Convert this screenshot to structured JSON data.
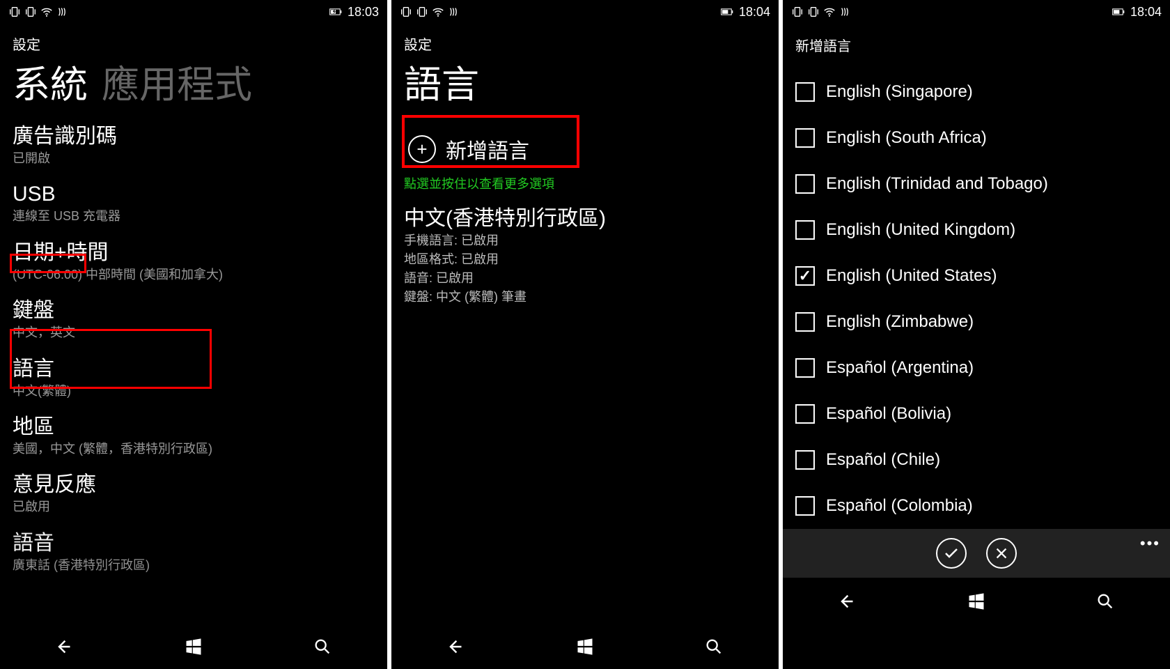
{
  "screen1": {
    "status": {
      "time": "18:03"
    },
    "header_small": "設定",
    "pivot_active": "系統",
    "pivot_inactive": "應用程式",
    "items": [
      {
        "title": "廣告識別碼",
        "sub": "已開啟"
      },
      {
        "title": "USB",
        "sub": "連線至 USB 充電器"
      },
      {
        "title": "日期+時間",
        "sub": "(UTC-06:00) 中部時間 (美國和加拿大)"
      },
      {
        "title": "鍵盤",
        "sub": "中文，英文"
      },
      {
        "title": "語言",
        "sub": "中文(繁體)"
      },
      {
        "title": "地區",
        "sub": "美國，中文 (繁體，香港特別行政區)"
      },
      {
        "title": "意見反應",
        "sub": "已啟用"
      },
      {
        "title": "語音",
        "sub": "廣東話 (香港特別行政區)"
      }
    ]
  },
  "screen2": {
    "status": {
      "time": "18:04"
    },
    "header_small": "設定",
    "page_title": "語言",
    "add_label": "新增語言",
    "hint": "點選並按住以查看更多選項",
    "lang_name": "中文(香港特別行政區)",
    "details": {
      "l1": "手機語言: 已啟用",
      "l2": "地區格式: 已啟用",
      "l3": "語音: 已啟用",
      "l4": "鍵盤: 中文 (繁體) 筆畫"
    }
  },
  "screen3": {
    "status": {
      "time": "18:04"
    },
    "page_title": "新增語言",
    "languages": [
      {
        "label": "English (Singapore)",
        "checked": false
      },
      {
        "label": "English (South Africa)",
        "checked": false
      },
      {
        "label": "English (Trinidad and Tobago)",
        "checked": false
      },
      {
        "label": "English (United Kingdom)",
        "checked": false
      },
      {
        "label": "English (United States)",
        "checked": true
      },
      {
        "label": "English (Zimbabwe)",
        "checked": false
      },
      {
        "label": "Español (Argentina)",
        "checked": false
      },
      {
        "label": "Español (Bolivia)",
        "checked": false
      },
      {
        "label": "Español (Chile)",
        "checked": false
      },
      {
        "label": "Español (Colombia)",
        "checked": false
      }
    ]
  }
}
